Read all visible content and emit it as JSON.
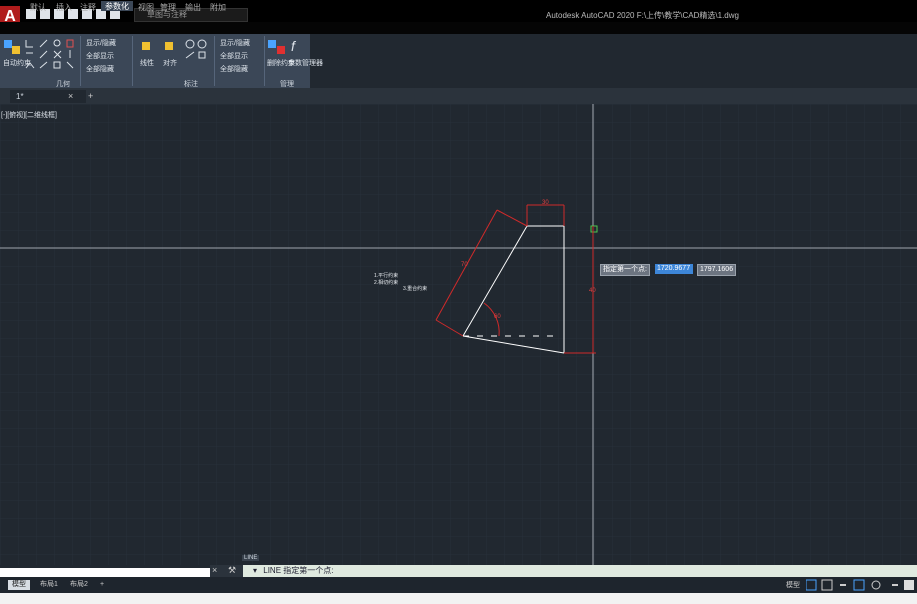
{
  "window": {
    "title": "Autodesk AutoCAD 2020    F:\\上传\\教学\\CAD精选\\1.dwg",
    "app_letter": "A"
  },
  "quick_access": {
    "workspace": "草图与注释"
  },
  "ribbon_tabs": [
    "默认",
    "插入",
    "注释",
    "参数化",
    "视图",
    "管理",
    "输出",
    "附加"
  ],
  "ribbon_active": "参数化",
  "ribbon": {
    "geom_panel": {
      "auto_constrain": "自动约束",
      "label": "几何"
    },
    "show_geom": [
      "显示/隐藏",
      "全部显示",
      "全部隐藏"
    ],
    "dim_panel": {
      "linear": "线性",
      "aligned": "对齐",
      "label": "标注"
    },
    "show_dim": [
      "显示/隐藏",
      "全部显示",
      "全部隐藏"
    ],
    "manage_panel": {
      "delete": "删除约束",
      "params": "参数管理器",
      "label": "管理"
    }
  },
  "doc_tab": {
    "name": "1*"
  },
  "viewport_label": "[-][俯视][二维线框]",
  "canvas": {
    "annotation_lines": [
      "1.平行约束",
      "2.相切约束",
      "3.重合约束"
    ],
    "dim_values": {
      "top": "30",
      "slant": "70",
      "angle": "60",
      "right": "40"
    }
  },
  "dynamic_input": {
    "prompt": "指定第一个点:",
    "x": "1720.9677",
    "y": "1797.1606"
  },
  "command": {
    "tag": "LINE",
    "text": "LINE 指定第一个点:"
  },
  "layout_tabs": [
    "模型",
    "布局1",
    "布局2"
  ],
  "status": {
    "model": "模型"
  }
}
